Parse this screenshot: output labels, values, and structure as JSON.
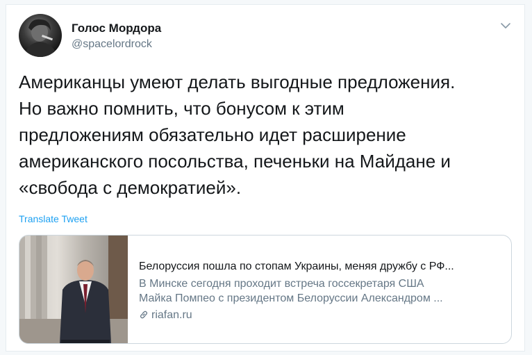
{
  "author": {
    "display_name": "Голос Мордора",
    "handle": "@spacelordrock"
  },
  "tweet": {
    "text": "Американцы умеют делать выгодные предложения.\nНо важно помнить, что бонусом к этим\nпредложениям обязательно идет расширение\nамериканского посольства, печеньки на Майдане и\n«свобода с демократией».",
    "translate_label": "Translate Tweet"
  },
  "card": {
    "title": "Белоруссия пошла по стопам Украины, меняя дружбу с РФ...",
    "description_line1": "В Минске сегодня проходит встреча госсекретаря США",
    "description_line2": "Майка Помпео с президентом Белоруссии Александром ...",
    "domain": "riafan.ru"
  },
  "colors": {
    "link": "#1da1f2",
    "secondary_text": "#657786",
    "border": "#ccd6dd"
  },
  "icons": {
    "caret": "chevron-down-icon",
    "link": "link-icon"
  }
}
